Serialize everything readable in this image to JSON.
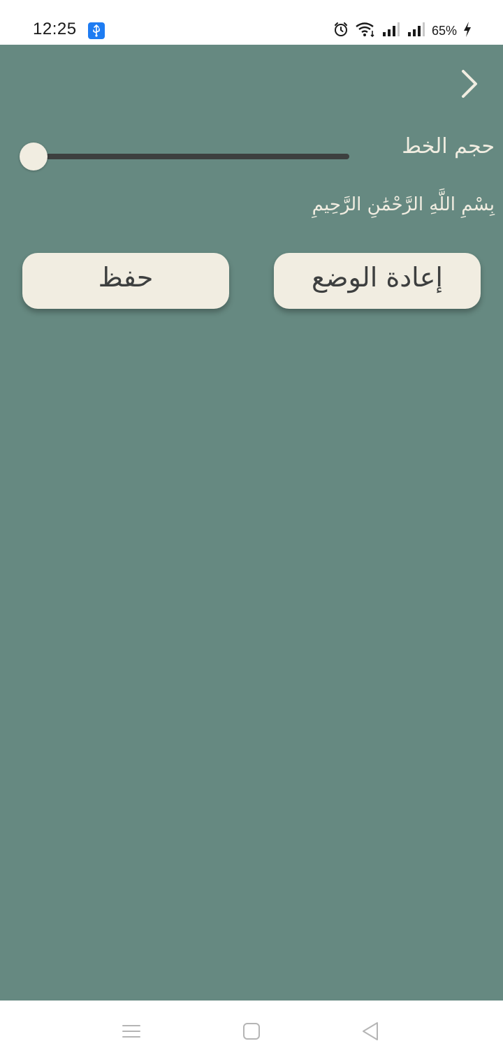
{
  "status_bar": {
    "time": "12:25",
    "battery_percent": "65%",
    "icons": [
      "usb-icon",
      "alarm-icon",
      "wifi-icon",
      "signal-icon",
      "signal-icon",
      "charging-icon"
    ]
  },
  "settings": {
    "font_size_label": "حجم الخط",
    "font_size_slider_value": 0.0,
    "preview_text": "بِسْمِ اللَّهِ الرَّحْمَٰنِ الرَّحِيمِ"
  },
  "actions": {
    "reset_label": "إعادة الوضع",
    "save_label": "حفظ"
  },
  "navigation": {
    "icons": [
      "menu-icon",
      "home-icon",
      "back-icon"
    ]
  },
  "colors": {
    "background": "#668981",
    "cream": "#f1ede1",
    "dark": "#3d3f3f"
  }
}
